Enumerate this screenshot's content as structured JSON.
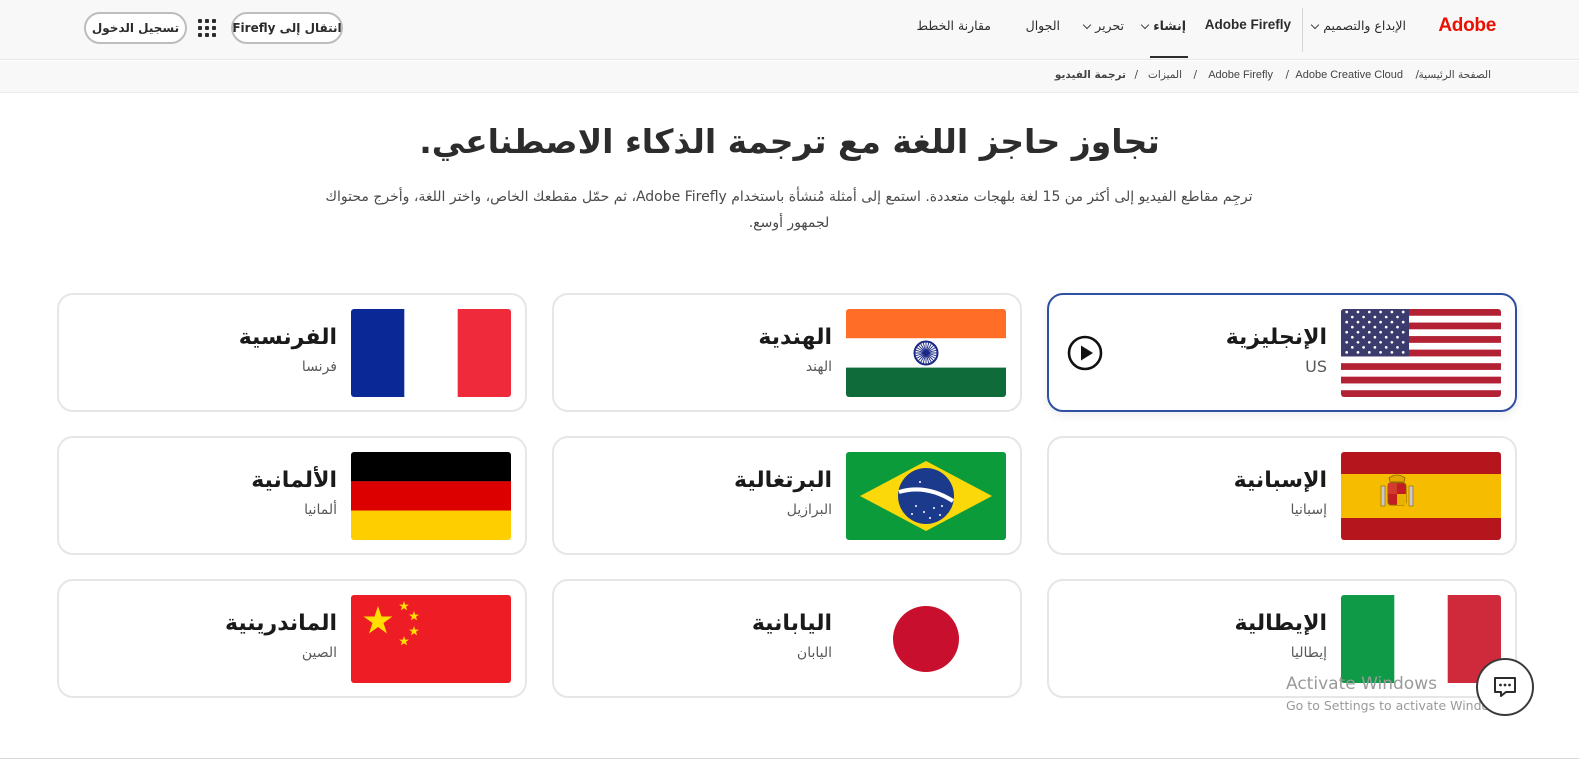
{
  "nav": {
    "logo": "Adobe",
    "items": {
      "creativity": "الإبداع والتصميم",
      "firefly": "Adobe Firefly",
      "create": "إنشاء",
      "edit": "تحرير",
      "mobile": "الجوال",
      "compare": "مقارنة الخطط"
    },
    "goto_firefly": "انتقال إلى Firefly",
    "signin": "تسجيل الدخول"
  },
  "breadcrumb": [
    "الصفحة الرئيسية",
    "Adobe Creative Cloud",
    "Adobe Firefly",
    "الميزات",
    "ترجمة الفيديو"
  ],
  "hero": {
    "title": "تجاوز حاجز اللغة مع ترجمة الذكاء الاصطناعي.",
    "subtitle": "ترجِم مقاطع الفيديو إلى أكثر من 15 لغة بلهجات متعددة. استمع إلى أمثلة مُنشأة باستخدام Adobe Firefly، ثم حمّل مقطعك الخاص، واختر اللغة، وأخرج محتواك لجمهور أوسع."
  },
  "languages": [
    {
      "name": "الإنجليزية",
      "region": "US",
      "flag": "flag-us-icon",
      "active": true
    },
    {
      "name": "الهندية",
      "region": "الهند",
      "flag": "flag-india-icon",
      "active": false
    },
    {
      "name": "الفرنسية",
      "region": "فرنسا",
      "flag": "flag-france-icon",
      "active": false
    },
    {
      "name": "الإسبانية",
      "region": "إسبانيا",
      "flag": "flag-spain-icon",
      "active": false
    },
    {
      "name": "البرتغالية",
      "region": "البرازيل",
      "flag": "flag-brazil-icon",
      "active": false
    },
    {
      "name": "الألمانية",
      "region": "ألمانيا",
      "flag": "flag-germany-icon",
      "active": false
    },
    {
      "name": "الإيطالية",
      "region": "إيطاليا",
      "flag": "flag-italy-icon",
      "active": false
    },
    {
      "name": "اليابانية",
      "region": "اليابان",
      "flag": "flag-japan-icon",
      "active": false
    },
    {
      "name": "الماندرينية",
      "region": "الصين",
      "flag": "flag-china-icon",
      "active": false
    }
  ],
  "overlay": {
    "activate_title": "Activate Windows",
    "activate_sub": "Go to Settings to activate Windows"
  },
  "colors": {
    "brand": "#eb1000",
    "active_border": "#2f4fa2",
    "text": "#2c2c2c"
  }
}
